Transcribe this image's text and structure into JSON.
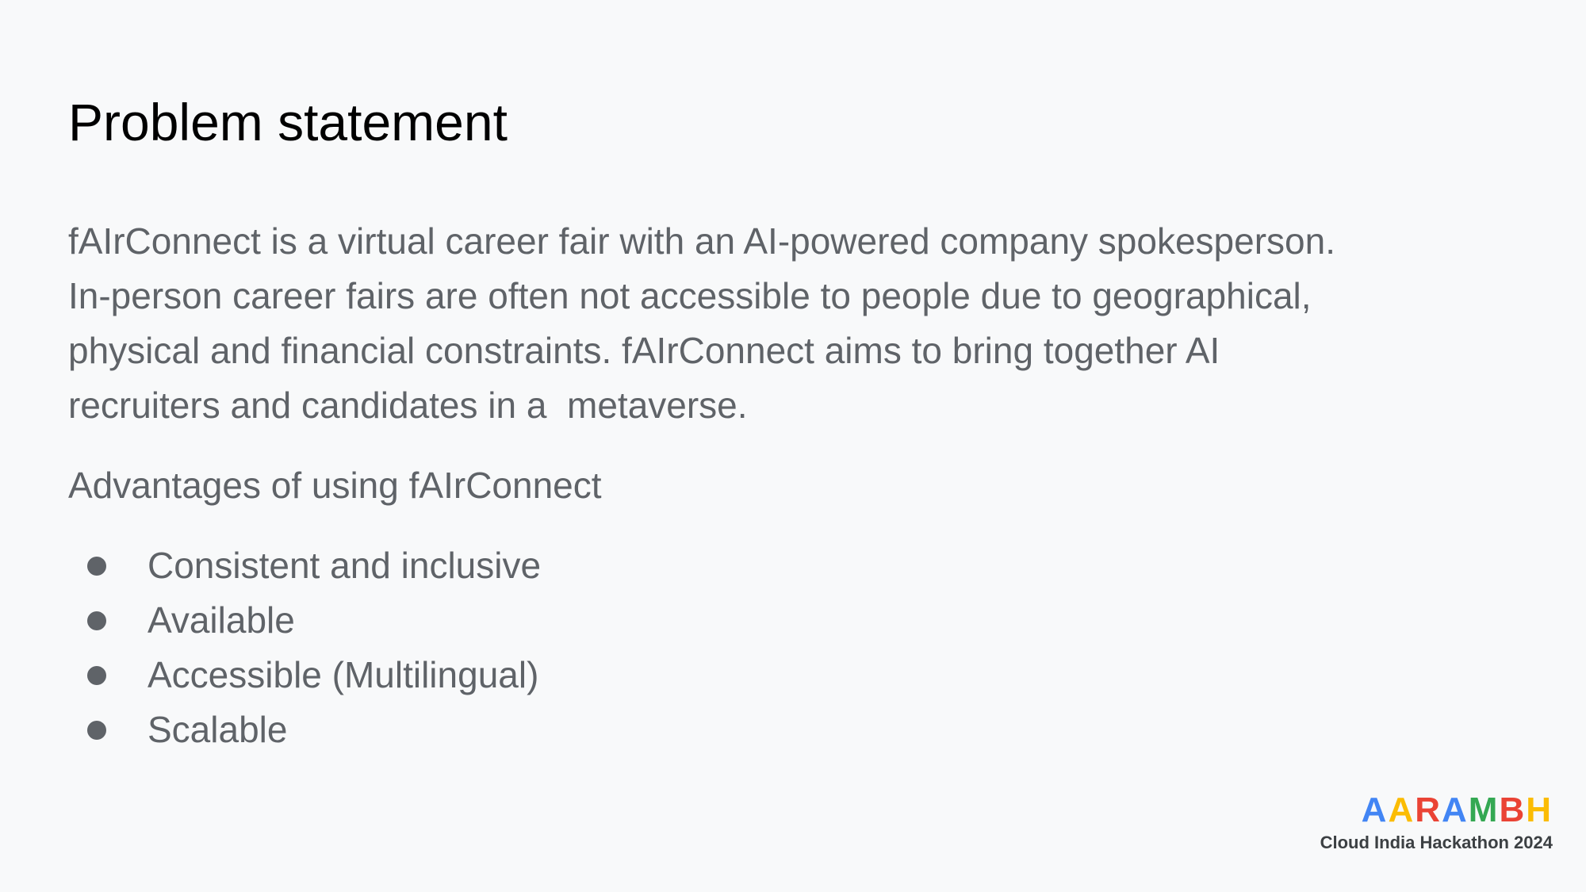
{
  "slide": {
    "title": "Problem statement",
    "paragraph_lines": [
      "fAIrConnect is a virtual career fair with an AI-powered company spokesperson.",
      "In-person career fairs are often not accessible to people due to geographical,",
      "physical and financial constraints. fAIrConnect aims to bring together AI",
      "recruiters and candidates in a  metaverse."
    ],
    "advantages_heading": "Advantages of using fAIrConnect",
    "advantages": [
      "Consistent and inclusive",
      "Available",
      "Accessible (Multilingual)",
      "Scalable"
    ]
  },
  "logo": {
    "letters": [
      "A",
      "A",
      "R",
      "A",
      "M",
      "B",
      "H"
    ],
    "letter_colors": [
      "#4285f4",
      "#fbbc04",
      "#ea4335",
      "#4285f4",
      "#34a853",
      "#ea4335",
      "#fbbc04"
    ],
    "subtitle": "Cloud India Hackathon 2024"
  },
  "colors": {
    "background": "#f8f9fa",
    "title": "#000000",
    "body_text": "#5f6368"
  }
}
